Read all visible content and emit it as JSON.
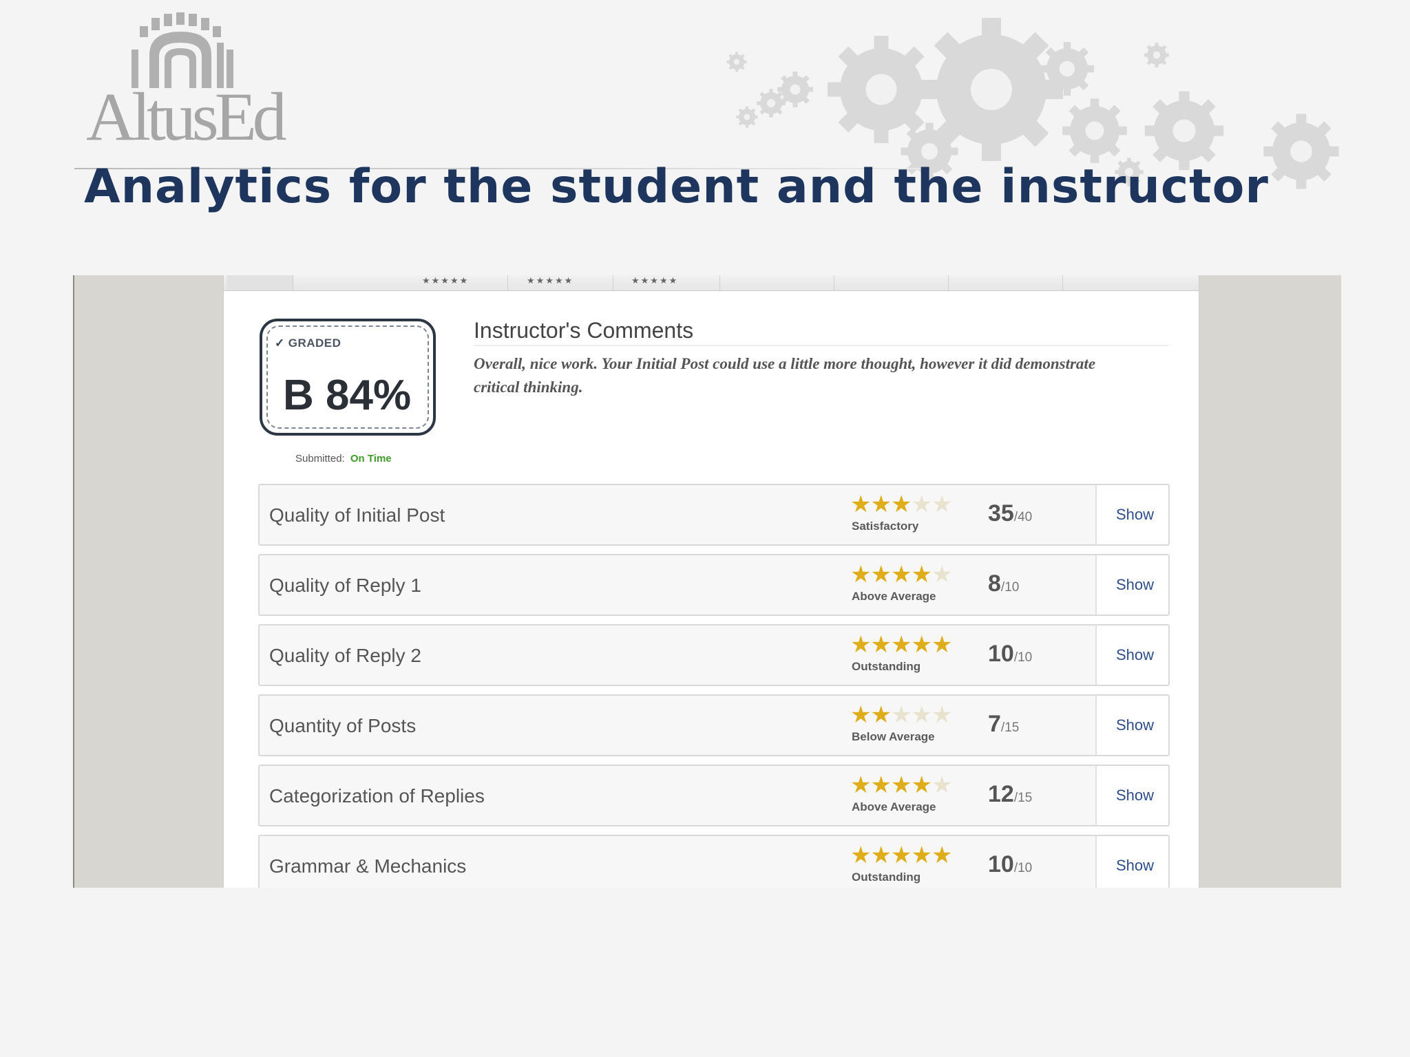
{
  "slide": {
    "logo_text": "AltusEd",
    "title": "Analytics for the student and the instructor"
  },
  "colors": {
    "title": "#1e355e",
    "stars": "#e0ad1a",
    "on_time": "#3f9b2a",
    "show_link": "#2e4d8a"
  },
  "grade": {
    "status_label": "GRADED",
    "letter_and_percent": "B 84%",
    "submitted_label": "Submitted:",
    "submitted_status": "On Time"
  },
  "comments": {
    "heading": "Instructor's Comments",
    "body": "Overall, nice work. Your Initial Post could use a little more thought, however it did demonstrate critical thinking."
  },
  "rubric": [
    {
      "criterion": "Quality of Initial Post",
      "stars": 3,
      "rating": "Satisfactory",
      "score": "35",
      "max": "/40",
      "action": "Show"
    },
    {
      "criterion": "Quality of Reply 1",
      "stars": 4,
      "rating": "Above Average",
      "score": "8",
      "max": "/10",
      "action": "Show"
    },
    {
      "criterion": "Quality of Reply 2",
      "stars": 5,
      "rating": "Outstanding",
      "score": "10",
      "max": "/10",
      "action": "Show"
    },
    {
      "criterion": "Quantity of Posts",
      "stars": 2,
      "rating": "Below Average",
      "score": "7",
      "max": "/15",
      "action": "Show"
    },
    {
      "criterion": "Categorization of Replies",
      "stars": 4,
      "rating": "Above Average",
      "score": "12",
      "max": "/15",
      "action": "Show"
    },
    {
      "criterion": "Grammar & Mechanics",
      "stars": 5,
      "rating": "Outstanding",
      "score": "10",
      "max": "/10",
      "action": "Show"
    }
  ]
}
